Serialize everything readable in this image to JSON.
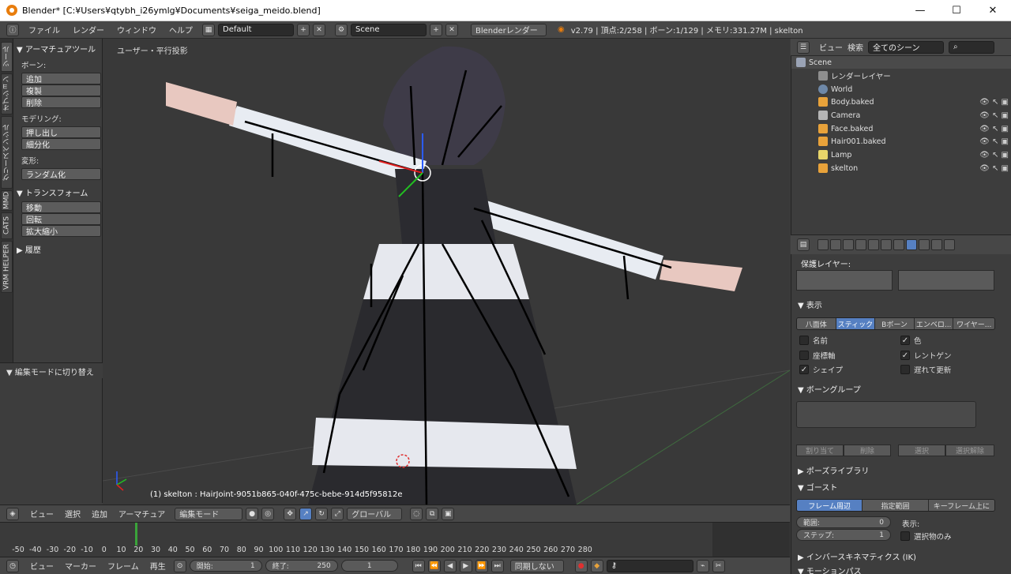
{
  "window": {
    "title": "Blender* [C:¥Users¥qtybh_i26ymlg¥Documents¥seiga_meido.blend]",
    "minimize": "—",
    "maximize": "☐",
    "close": "✕"
  },
  "infobar": {
    "menus": [
      "ファイル",
      "レンダー",
      "ウィンドウ",
      "ヘルプ"
    ],
    "layout": "Default",
    "scene": "Scene",
    "engine": "Blenderレンダー",
    "stats": "v2.79 | 頂点:2/258 | ボーン:1/129 | メモリ:331.27M | skelton"
  },
  "toolshelf_tabs": [
    "ツール",
    "オプション",
    "グリースペンシル",
    "MMD",
    "CATS",
    "VRM HELPER"
  ],
  "toolshelf": {
    "armature_tools": "▼ アーマチュアツール",
    "bone_label": "ボーン:",
    "bone_buttons": [
      "追加",
      "複製",
      "削除"
    ],
    "modeling_label": "モデリング:",
    "modeling_buttons": [
      "押し出し",
      "細分化"
    ],
    "deform_label": "変形:",
    "deform_buttons": [
      "ランダム化"
    ],
    "transform_section": "▼ トランスフォーム",
    "transform_buttons": [
      "移動",
      "回転",
      "拡大縮小"
    ],
    "history_section": "▶ 履歴"
  },
  "operator_panel": "▼ 編集モードに切り替え",
  "viewport": {
    "label": "ユーザー・平行投影",
    "status": "(1) skelton : HairJoint-9051b865-040f-475c-bebe-914d5f95812e"
  },
  "outliner": {
    "view": "ビュー",
    "search": "検索",
    "filter": "全てのシーン",
    "rows": [
      {
        "label": "Scene",
        "color": "#9aa3b5"
      },
      {
        "label": "レンダーレイヤー",
        "color": "#8e8e8e"
      },
      {
        "label": "World",
        "color": "#6e88a8"
      },
      {
        "label": "Body.baked",
        "color": "#e8a23a"
      },
      {
        "label": "Camera",
        "color": "#b5b5b5"
      },
      {
        "label": "Face.baked",
        "color": "#e8a23a"
      },
      {
        "label": "Hair001.baked",
        "color": "#e8a23a"
      },
      {
        "label": "Lamp",
        "color": "#e8d56a"
      },
      {
        "label": "skelton",
        "color": "#e8a23a"
      }
    ]
  },
  "properties": {
    "protected_layers": "保護レイヤー:",
    "display_section": "▼ 表示",
    "display_modes": [
      "八面体",
      "スティック",
      "Bボーン",
      "エンベロ...",
      "ワイヤー..."
    ],
    "active_mode": "スティック",
    "checks": [
      {
        "label": "名前",
        "checked": false
      },
      {
        "label": "色",
        "checked": true
      },
      {
        "label": "座標軸",
        "checked": false
      },
      {
        "label": "レントゲン",
        "checked": true
      },
      {
        "label": "シェイプ",
        "checked": true
      },
      {
        "label": "遅れて更新",
        "checked": false
      }
    ],
    "bone_groups_section": "▼ ボーングループ",
    "group_buttons": [
      "割り当て",
      "削除",
      "選択",
      "選択解除"
    ],
    "pose_library_section": "▶ ポーズライブラリ",
    "ghost_section": "▼ ゴースト",
    "ghost_modes": [
      "フレーム周辺",
      "指定範囲",
      "キーフレーム上に"
    ],
    "active_ghost": "フレーム周辺",
    "range_label": "範囲:",
    "range_value": "0",
    "step_label": "ステップ:",
    "step_value": "1",
    "display_label": "表示:",
    "selected_only": "選択物のみ",
    "ik_section": "▶ インバースキネマティクス (IK)",
    "motion_section": "▼ モーションパス"
  },
  "viewport_header": {
    "menus": [
      "ビュー",
      "選択",
      "追加",
      "アーマチュア"
    ],
    "mode": "編集モード",
    "orientation": "グローバル"
  },
  "timeline": {
    "ticks": [
      "-50",
      "-40",
      "-30",
      "-20",
      "-10",
      "0",
      "10",
      "20",
      "30",
      "40",
      "50",
      "60",
      "70",
      "80",
      "90",
      "100",
      "110",
      "120",
      "130",
      "140",
      "150",
      "160",
      "170",
      "180",
      "190",
      "200",
      "210",
      "220",
      "230",
      "240",
      "250",
      "260",
      "270",
      "280"
    ],
    "current_frame": 1,
    "menus": [
      "ビュー",
      "マーカー",
      "フレーム",
      "再生"
    ],
    "start_label": "開始:",
    "start": "1",
    "end_label": "終了:",
    "end": "250",
    "frame": "1",
    "sync": "同期しない"
  }
}
